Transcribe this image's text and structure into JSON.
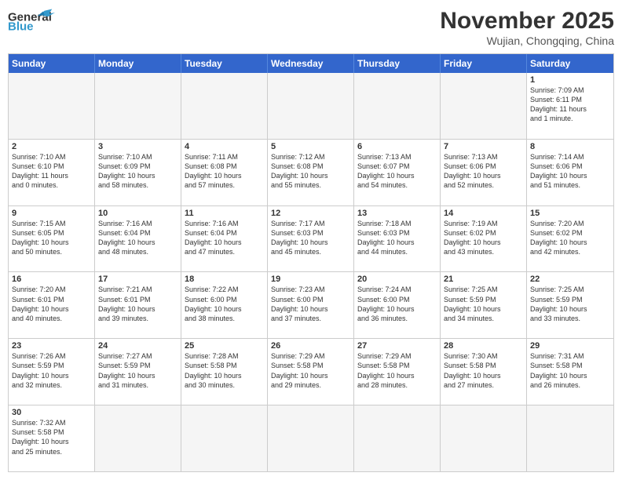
{
  "header": {
    "logo_general": "General",
    "logo_blue": "Blue",
    "month_year": "November 2025",
    "location": "Wujian, Chongqing, China"
  },
  "weekdays": [
    "Sunday",
    "Monday",
    "Tuesday",
    "Wednesday",
    "Thursday",
    "Friday",
    "Saturday"
  ],
  "rows": [
    [
      {
        "day": "",
        "info": ""
      },
      {
        "day": "",
        "info": ""
      },
      {
        "day": "",
        "info": ""
      },
      {
        "day": "",
        "info": ""
      },
      {
        "day": "",
        "info": ""
      },
      {
        "day": "",
        "info": ""
      },
      {
        "day": "1",
        "info": "Sunrise: 7:09 AM\nSunset: 6:11 PM\nDaylight: 11 hours\nand 1 minute."
      }
    ],
    [
      {
        "day": "2",
        "info": "Sunrise: 7:10 AM\nSunset: 6:10 PM\nDaylight: 11 hours\nand 0 minutes."
      },
      {
        "day": "3",
        "info": "Sunrise: 7:10 AM\nSunset: 6:09 PM\nDaylight: 10 hours\nand 58 minutes."
      },
      {
        "day": "4",
        "info": "Sunrise: 7:11 AM\nSunset: 6:08 PM\nDaylight: 10 hours\nand 57 minutes."
      },
      {
        "day": "5",
        "info": "Sunrise: 7:12 AM\nSunset: 6:08 PM\nDaylight: 10 hours\nand 55 minutes."
      },
      {
        "day": "6",
        "info": "Sunrise: 7:13 AM\nSunset: 6:07 PM\nDaylight: 10 hours\nand 54 minutes."
      },
      {
        "day": "7",
        "info": "Sunrise: 7:13 AM\nSunset: 6:06 PM\nDaylight: 10 hours\nand 52 minutes."
      },
      {
        "day": "8",
        "info": "Sunrise: 7:14 AM\nSunset: 6:06 PM\nDaylight: 10 hours\nand 51 minutes."
      }
    ],
    [
      {
        "day": "9",
        "info": "Sunrise: 7:15 AM\nSunset: 6:05 PM\nDaylight: 10 hours\nand 50 minutes."
      },
      {
        "day": "10",
        "info": "Sunrise: 7:16 AM\nSunset: 6:04 PM\nDaylight: 10 hours\nand 48 minutes."
      },
      {
        "day": "11",
        "info": "Sunrise: 7:16 AM\nSunset: 6:04 PM\nDaylight: 10 hours\nand 47 minutes."
      },
      {
        "day": "12",
        "info": "Sunrise: 7:17 AM\nSunset: 6:03 PM\nDaylight: 10 hours\nand 45 minutes."
      },
      {
        "day": "13",
        "info": "Sunrise: 7:18 AM\nSunset: 6:03 PM\nDaylight: 10 hours\nand 44 minutes."
      },
      {
        "day": "14",
        "info": "Sunrise: 7:19 AM\nSunset: 6:02 PM\nDaylight: 10 hours\nand 43 minutes."
      },
      {
        "day": "15",
        "info": "Sunrise: 7:20 AM\nSunset: 6:02 PM\nDaylight: 10 hours\nand 42 minutes."
      }
    ],
    [
      {
        "day": "16",
        "info": "Sunrise: 7:20 AM\nSunset: 6:01 PM\nDaylight: 10 hours\nand 40 minutes."
      },
      {
        "day": "17",
        "info": "Sunrise: 7:21 AM\nSunset: 6:01 PM\nDaylight: 10 hours\nand 39 minutes."
      },
      {
        "day": "18",
        "info": "Sunrise: 7:22 AM\nSunset: 6:00 PM\nDaylight: 10 hours\nand 38 minutes."
      },
      {
        "day": "19",
        "info": "Sunrise: 7:23 AM\nSunset: 6:00 PM\nDaylight: 10 hours\nand 37 minutes."
      },
      {
        "day": "20",
        "info": "Sunrise: 7:24 AM\nSunset: 6:00 PM\nDaylight: 10 hours\nand 36 minutes."
      },
      {
        "day": "21",
        "info": "Sunrise: 7:25 AM\nSunset: 5:59 PM\nDaylight: 10 hours\nand 34 minutes."
      },
      {
        "day": "22",
        "info": "Sunrise: 7:25 AM\nSunset: 5:59 PM\nDaylight: 10 hours\nand 33 minutes."
      }
    ],
    [
      {
        "day": "23",
        "info": "Sunrise: 7:26 AM\nSunset: 5:59 PM\nDaylight: 10 hours\nand 32 minutes."
      },
      {
        "day": "24",
        "info": "Sunrise: 7:27 AM\nSunset: 5:59 PM\nDaylight: 10 hours\nand 31 minutes."
      },
      {
        "day": "25",
        "info": "Sunrise: 7:28 AM\nSunset: 5:58 PM\nDaylight: 10 hours\nand 30 minutes."
      },
      {
        "day": "26",
        "info": "Sunrise: 7:29 AM\nSunset: 5:58 PM\nDaylight: 10 hours\nand 29 minutes."
      },
      {
        "day": "27",
        "info": "Sunrise: 7:29 AM\nSunset: 5:58 PM\nDaylight: 10 hours\nand 28 minutes."
      },
      {
        "day": "28",
        "info": "Sunrise: 7:30 AM\nSunset: 5:58 PM\nDaylight: 10 hours\nand 27 minutes."
      },
      {
        "day": "29",
        "info": "Sunrise: 7:31 AM\nSunset: 5:58 PM\nDaylight: 10 hours\nand 26 minutes."
      }
    ],
    [
      {
        "day": "30",
        "info": "Sunrise: 7:32 AM\nSunset: 5:58 PM\nDaylight: 10 hours\nand 25 minutes."
      },
      {
        "day": "",
        "info": ""
      },
      {
        "day": "",
        "info": ""
      },
      {
        "day": "",
        "info": ""
      },
      {
        "day": "",
        "info": ""
      },
      {
        "day": "",
        "info": ""
      },
      {
        "day": "",
        "info": ""
      }
    ]
  ]
}
